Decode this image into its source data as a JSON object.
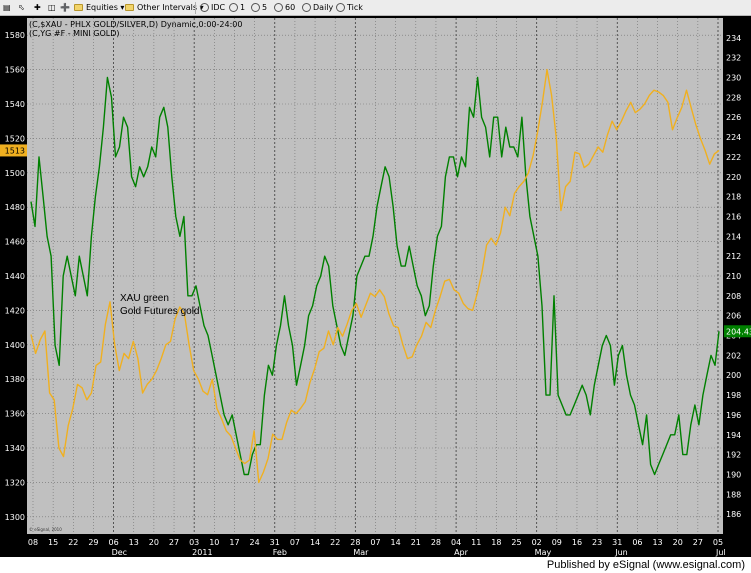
{
  "toolbar": {
    "equities": "Equities",
    "other_intervals": "Other Intervals",
    "idc": "IDC",
    "int_1": "1",
    "int_5": "5",
    "int_60": "60",
    "daily": "Daily",
    "tick": "Tick"
  },
  "footer": {
    "published": "Published by eSignal (www.esignal.com)"
  },
  "chart_data": {
    "type": "line",
    "header_line1": "(C,$XAU - PHLX GOLD/SILVER,D) Dynamic,0:00-24:00",
    "header_line2": "(C,YG #F - MINI GOLD)",
    "annotations": [
      "XAU green",
      "Gold Futures gold"
    ],
    "copyright": "© eSignal, 2010",
    "background": "#c0c0c0",
    "grid": true,
    "left_axis": {
      "range": [
        1290,
        1590
      ],
      "ticks": [
        1300,
        1320,
        1340,
        1360,
        1380,
        1400,
        1420,
        1440,
        1460,
        1480,
        1500,
        1520,
        1540,
        1560,
        1580
      ],
      "last_value_label": "1513"
    },
    "right_axis": {
      "range": [
        184,
        236
      ],
      "ticks": [
        186,
        188,
        190,
        192,
        194,
        196,
        198,
        200,
        202,
        204,
        206,
        208,
        210,
        212,
        214,
        216,
        218,
        220,
        222,
        224,
        226,
        228,
        230,
        232,
        234
      ],
      "last_value_label": "204.43"
    },
    "x_ticks": [
      "08",
      "15",
      "22",
      "29",
      "06",
      "13",
      "20",
      "27",
      "03",
      "10",
      "17",
      "24",
      "31",
      "07",
      "14",
      "22",
      "28",
      "07",
      "14",
      "21",
      "28",
      "04",
      "11",
      "18",
      "25",
      "02",
      "09",
      "16",
      "23",
      "31",
      "06",
      "13",
      "20",
      "27",
      "05"
    ],
    "month_labels": [
      {
        "label": "Dec",
        "tick": 4
      },
      {
        "label": "2011",
        "tick": 8
      },
      {
        "label": "Feb",
        "tick": 12
      },
      {
        "label": "Mar",
        "tick": 16
      },
      {
        "label": "Apr",
        "tick": 21
      },
      {
        "label": "May",
        "tick": 25
      },
      {
        "label": "Jun",
        "tick": 29
      },
      {
        "label": "Jul",
        "tick": 34
      }
    ],
    "major_gridlines_at_ticks": [
      4,
      8,
      12,
      16,
      21,
      25,
      29,
      34
    ],
    "series": [
      {
        "name": "XAU green",
        "axis": "right",
        "color": "#008000",
        "values": [
          217.5,
          215,
          222,
          218,
          214,
          212,
          203,
          201,
          210,
          212,
          210,
          208,
          212,
          210,
          208,
          214,
          218,
          221,
          225,
          230,
          228,
          222,
          223,
          226,
          225,
          220,
          219,
          221,
          220,
          221,
          223,
          222,
          226,
          227,
          225,
          220,
          216,
          214,
          216,
          208,
          208,
          209,
          207,
          205,
          204,
          202,
          200,
          198,
          196,
          195,
          196,
          194,
          192,
          190,
          190,
          192,
          193,
          193,
          198,
          201,
          200,
          203,
          205,
          208,
          205,
          203,
          199,
          201,
          203,
          206,
          207,
          209,
          210,
          212,
          211,
          207,
          205,
          203,
          202,
          204,
          206,
          210,
          211,
          212,
          212,
          214,
          217,
          219,
          221,
          220,
          217,
          213,
          211,
          211,
          213,
          211,
          209,
          208,
          206,
          207,
          211,
          214,
          215,
          220,
          222,
          222,
          220,
          222,
          221,
          227,
          226,
          230,
          226,
          225,
          222,
          226,
          226,
          222,
          225,
          223,
          223,
          222,
          226,
          220,
          216,
          214,
          212,
          207,
          198,
          198,
          208,
          198,
          197,
          196,
          196,
          197,
          198,
          199,
          198,
          196,
          199,
          201,
          203,
          204,
          203,
          199,
          202,
          203,
          200,
          198,
          197,
          195,
          193,
          196,
          191,
          190,
          191,
          192,
          193,
          194,
          194,
          196,
          192,
          192,
          195,
          197,
          195,
          198,
          200,
          202,
          201,
          204.43
        ]
      },
      {
        "name": "Gold Futures gold",
        "axis": "left",
        "color": "#f0b020",
        "values": [
          1406,
          1395,
          1403,
          1408,
          1372,
          1368,
          1340,
          1335,
          1353,
          1363,
          1377,
          1375,
          1368,
          1372,
          1388,
          1390,
          1412,
          1425,
          1400,
          1385,
          1395,
          1392,
          1402,
          1392,
          1372,
          1377,
          1380,
          1385,
          1392,
          1400,
          1402,
          1415,
          1422,
          1418,
          1400,
          1385,
          1380,
          1373,
          1371,
          1380,
          1363,
          1357,
          1350,
          1347,
          1340,
          1333,
          1331,
          1333,
          1350,
          1320,
          1326,
          1334,
          1348,
          1345,
          1345,
          1355,
          1362,
          1360,
          1363,
          1367,
          1378,
          1386,
          1396,
          1398,
          1408,
          1400,
          1410,
          1405,
          1412,
          1420,
          1424,
          1416,
          1423,
          1430,
          1428,
          1432,
          1428,
          1418,
          1411,
          1410,
          1400,
          1392,
          1393,
          1400,
          1405,
          1413,
          1410,
          1420,
          1428,
          1437,
          1438,
          1432,
          1430,
          1424,
          1421,
          1420,
          1430,
          1442,
          1458,
          1462,
          1458,
          1465,
          1480,
          1475,
          1488,
          1492,
          1495,
          1500,
          1510,
          1524,
          1541,
          1560,
          1545,
          1520,
          1478,
          1492,
          1495,
          1512,
          1511,
          1503,
          1505,
          1510,
          1515,
          1512,
          1522,
          1530,
          1525,
          1530,
          1536,
          1541,
          1535,
          1537,
          1540,
          1545,
          1548,
          1547,
          1545,
          1541,
          1525,
          1532,
          1538,
          1548,
          1538,
          1528,
          1520,
          1513,
          1505,
          1511,
          1513
        ]
      }
    ]
  }
}
